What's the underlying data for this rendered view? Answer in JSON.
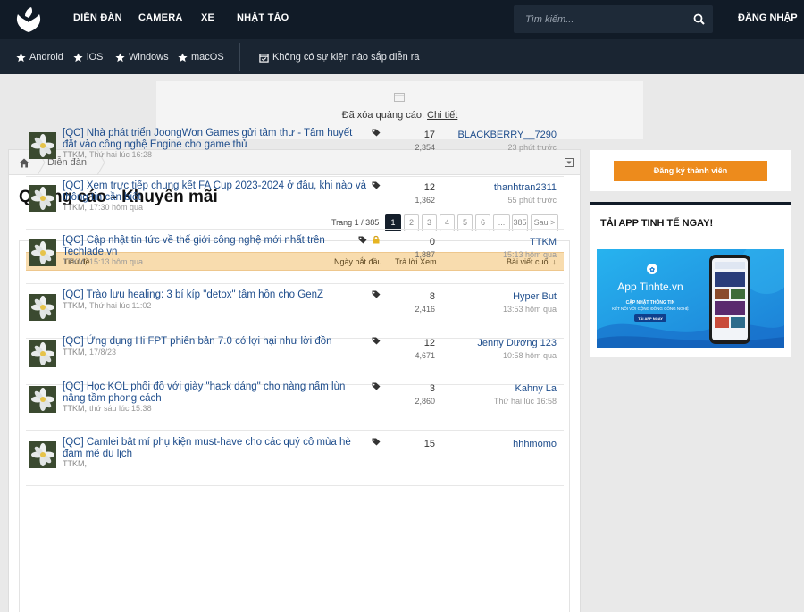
{
  "topbar": {
    "nav": [
      "DIỄN ĐÀN",
      "CAMERA",
      "XE",
      "NHẬT TẢO"
    ],
    "search_placeholder": "Tìm kiếm...",
    "login": "ĐĂNG NHẬP"
  },
  "subbar": {
    "platforms": [
      "Android",
      "iOS",
      "Windows",
      "macOS"
    ],
    "events": "Không có sự kiện nào sắp diễn ra"
  },
  "ad": {
    "text": "Đã xóa quảng cáo.",
    "link": "Chi tiết"
  },
  "breadcrumb": {
    "label": "Diễn đàn"
  },
  "page_title": "Quảng cáo - Khuyến mãi",
  "pager": {
    "label": "Trang 1 / 385",
    "pages": [
      "1",
      "2",
      "3",
      "4",
      "5",
      "6",
      "...",
      "385",
      "Sau >"
    ]
  },
  "table": {
    "headers": {
      "title": "Tiêu đề",
      "start_date": "Ngày bắt đầu",
      "replies_views": "Trả lời  Xem",
      "last_post": "Bài viết cuối ↓"
    },
    "rows": [
      {
        "title": "[QC] Nhà phát triển JoongWon Games gửi tâm thư - Tâm huyết đặt vào công nghệ Engine cho game thủ",
        "author": "TTKM,",
        "date": "Thứ hai lúc 16:28",
        "replies": "17",
        "views": "2,354",
        "last_user": "BLACKBERRY__7290",
        "last_time": "23 phút trước",
        "locked": false
      },
      {
        "title": "[QC] Xem trực tiếp chung kết FA Cup 2023-2024 ở đâu, khi nào và thông tin cần biết",
        "author": "TTKM,",
        "date": "17:30 hôm qua",
        "replies": "12",
        "views": "1,362",
        "last_user": "thanhtran2311",
        "last_time": "55 phút trước",
        "locked": false
      },
      {
        "title": "[QC] Cập nhật tin tức về thế giới công nghệ mới nhất trên Techlade.vn",
        "author": "TTKM,",
        "date": "15:13 hôm qua",
        "replies": "0",
        "views": "1,887",
        "last_user": "TTKM",
        "last_time": "15:13 hôm qua",
        "locked": true
      },
      {
        "title": "[QC] Trào lưu healing: 3 bí kíp \"detox\" tâm hồn cho GenZ",
        "author": "TTKM,",
        "date": "Thứ hai lúc 11:02",
        "replies": "8",
        "views": "2,416",
        "last_user": "Hyper But",
        "last_time": "13:53 hôm qua",
        "locked": false
      },
      {
        "title": "[QC] Ứng dụng Hi FPT phiên bản 7.0 có lợi hại như lời đồn",
        "author": "TTKM,",
        "date": "17/8/23",
        "replies": "12",
        "views": "4,671",
        "last_user": "Jenny Dương 123",
        "last_time": "10:58 hôm qua",
        "locked": false
      },
      {
        "title": "[QC] Học KOL phối đồ với giày \"hack dáng\" cho nàng nấm lùn nâng tầm phong cách",
        "author": "TTKM,",
        "date": "thứ sáu lúc 15:38",
        "replies": "3",
        "views": "2,860",
        "last_user": "Kahny La",
        "last_time": "Thứ hai lúc 16:58",
        "locked": false
      },
      {
        "title": "[QC] Camlei bật mí phụ kiện must-have cho các quý cô mùa hè đam mê du lịch",
        "author": "TTKM,",
        "date": "",
        "replies": "15",
        "views": "",
        "last_user": "hhhmomo",
        "last_time": "",
        "locked": false
      }
    ]
  },
  "sidebar": {
    "register": "Đăng ký thành viên",
    "app_title": "TẢI APP TINH TẾ NGAY!",
    "banner": {
      "brand": "App Tinhte.vn",
      "tagline1": "CẬP NHẬT THÔNG TIN",
      "tagline2": "KẾT NỐI VỚI CỘNG ĐỒNG CÔNG NGHỆ",
      "cta": "TẢI APP NGAY"
    }
  },
  "colors": {
    "topbar": "#111b27",
    "accent": "#ed8b1c",
    "link": "#1e4d8c",
    "header_bg": "#f8dcae"
  }
}
